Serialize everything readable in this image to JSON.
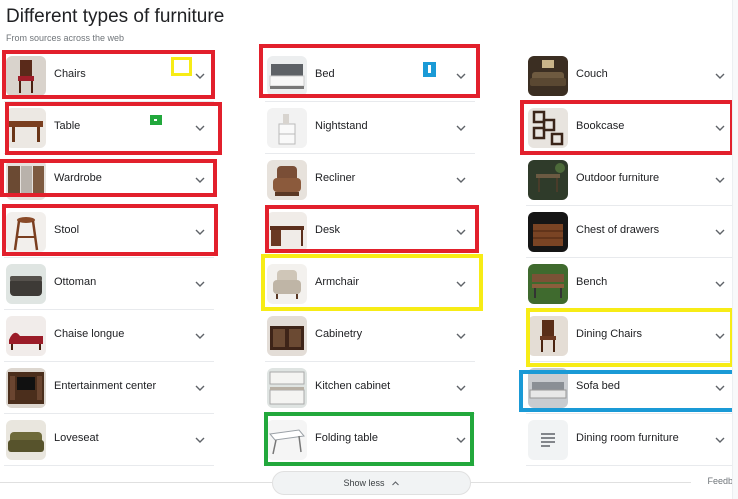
{
  "header": {
    "title": "Different types of furniture",
    "subtitle": "From sources across the web"
  },
  "columns": [
    {
      "items": [
        {
          "label": "Chairs",
          "icon": "chair-thumbnail"
        },
        {
          "label": "Table",
          "icon": "table-thumbnail"
        },
        {
          "label": "Wardrobe",
          "icon": "wardrobe-thumbnail"
        },
        {
          "label": "Stool",
          "icon": "stool-thumbnail"
        },
        {
          "label": "Ottoman",
          "icon": "ottoman-thumbnail"
        },
        {
          "label": "Chaise longue",
          "icon": "chaise-longue-thumbnail"
        },
        {
          "label": "Entertainment center",
          "icon": "entertainment-center-thumbnail"
        },
        {
          "label": "Loveseat",
          "icon": "loveseat-thumbnail"
        }
      ]
    },
    {
      "items": [
        {
          "label": "Bed",
          "icon": "bed-thumbnail"
        },
        {
          "label": "Nightstand",
          "icon": "nightstand-thumbnail"
        },
        {
          "label": "Recliner",
          "icon": "recliner-thumbnail"
        },
        {
          "label": "Desk",
          "icon": "desk-thumbnail"
        },
        {
          "label": "Armchair",
          "icon": "armchair-thumbnail"
        },
        {
          "label": "Cabinetry",
          "icon": "cabinetry-thumbnail"
        },
        {
          "label": "Kitchen cabinet",
          "icon": "kitchen-cabinet-thumbnail"
        },
        {
          "label": "Folding table",
          "icon": "folding-table-thumbnail"
        }
      ]
    },
    {
      "items": [
        {
          "label": "Couch",
          "icon": "couch-thumbnail"
        },
        {
          "label": "Bookcase",
          "icon": "bookcase-thumbnail"
        },
        {
          "label": "Outdoor furniture",
          "icon": "outdoor-furniture-thumbnail"
        },
        {
          "label": "Chest of drawers",
          "icon": "chest-of-drawers-thumbnail"
        },
        {
          "label": "Bench",
          "icon": "bench-thumbnail"
        },
        {
          "label": "Dining Chairs",
          "icon": "dining-chairs-thumbnail"
        },
        {
          "label": "Sofa bed",
          "icon": "sofa-bed-thumbnail"
        },
        {
          "label": "Dining room furniture",
          "icon": "document-icon"
        }
      ]
    }
  ],
  "footer": {
    "show_less_label": "Show less",
    "feedback_label": "Feedba"
  },
  "annotation_colors": {
    "red": "#e2202c",
    "yellow": "#f7ec16",
    "green": "#22a83c",
    "blue": "#1a9ad6"
  }
}
